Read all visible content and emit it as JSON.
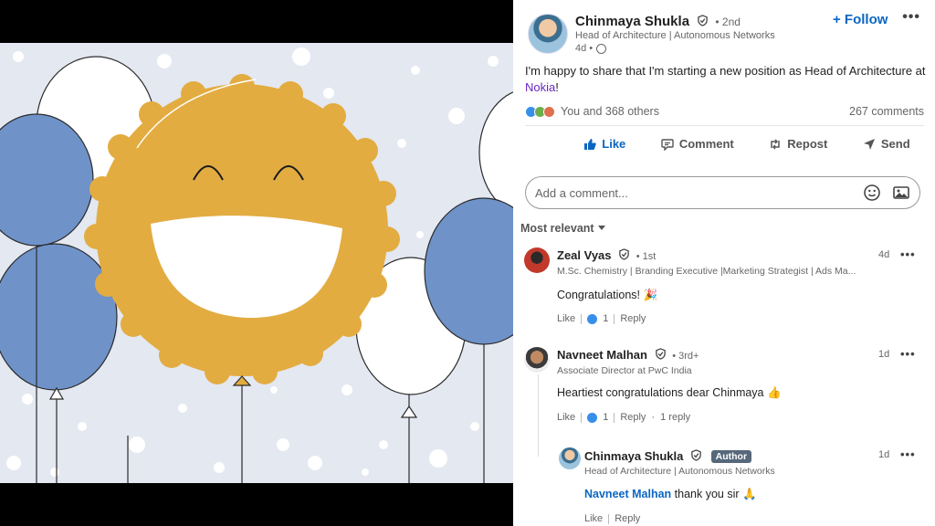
{
  "post": {
    "author_name": "Chinmaya Shukla",
    "degree": "• 2nd",
    "headline": "Head of Architecture | Autonomous Networks",
    "time": "4d •",
    "follow_label": "+ Follow",
    "more": "•••",
    "text_before": "I'm happy to share that I'm starting a new position as Head of Architecture at ",
    "text_mention": "Nokia",
    "text_after": "!",
    "reactions_label": "You and 368 others",
    "comments_count": "267 comments"
  },
  "actions": {
    "like": "Like",
    "comment": "Comment",
    "repost": "Repost",
    "send": "Send"
  },
  "comment_box": {
    "placeholder": "Add a comment..."
  },
  "sort_label": "Most relevant",
  "comments": [
    {
      "name": "Zeal Vyas",
      "degree": "• 1st",
      "headline": "M.Sc. Chemistry | Branding Executive |Marketing Strategist | Ads Ma...",
      "time": "4d",
      "text": "Congratulations! 🎉",
      "like": "Like",
      "like_count": "1",
      "reply": "Reply"
    },
    {
      "name": "Navneet Malhan",
      "degree": "• 3rd+",
      "headline": "Associate Director at PwC India",
      "time": "1d",
      "text": "Heartiest congratulations dear Chinmaya 👍",
      "like": "Like",
      "like_count": "1",
      "reply": "Reply",
      "reply_count": "1 reply"
    }
  ],
  "reply": {
    "name": "Chinmaya Shukla",
    "badge": "Author",
    "headline": "Head of Architecture | Autonomous Networks",
    "time": "1d",
    "mention": "Navneet Malhan",
    "text": " thank you sir 🙏",
    "like": "Like",
    "reply": "Reply"
  },
  "colors": {
    "accent": "#0a66c2",
    "mention_company": "#6a28c2",
    "balloon_blue": "#6f92c8",
    "smiley": "#e3ac41",
    "background": "#e3e8f1"
  }
}
